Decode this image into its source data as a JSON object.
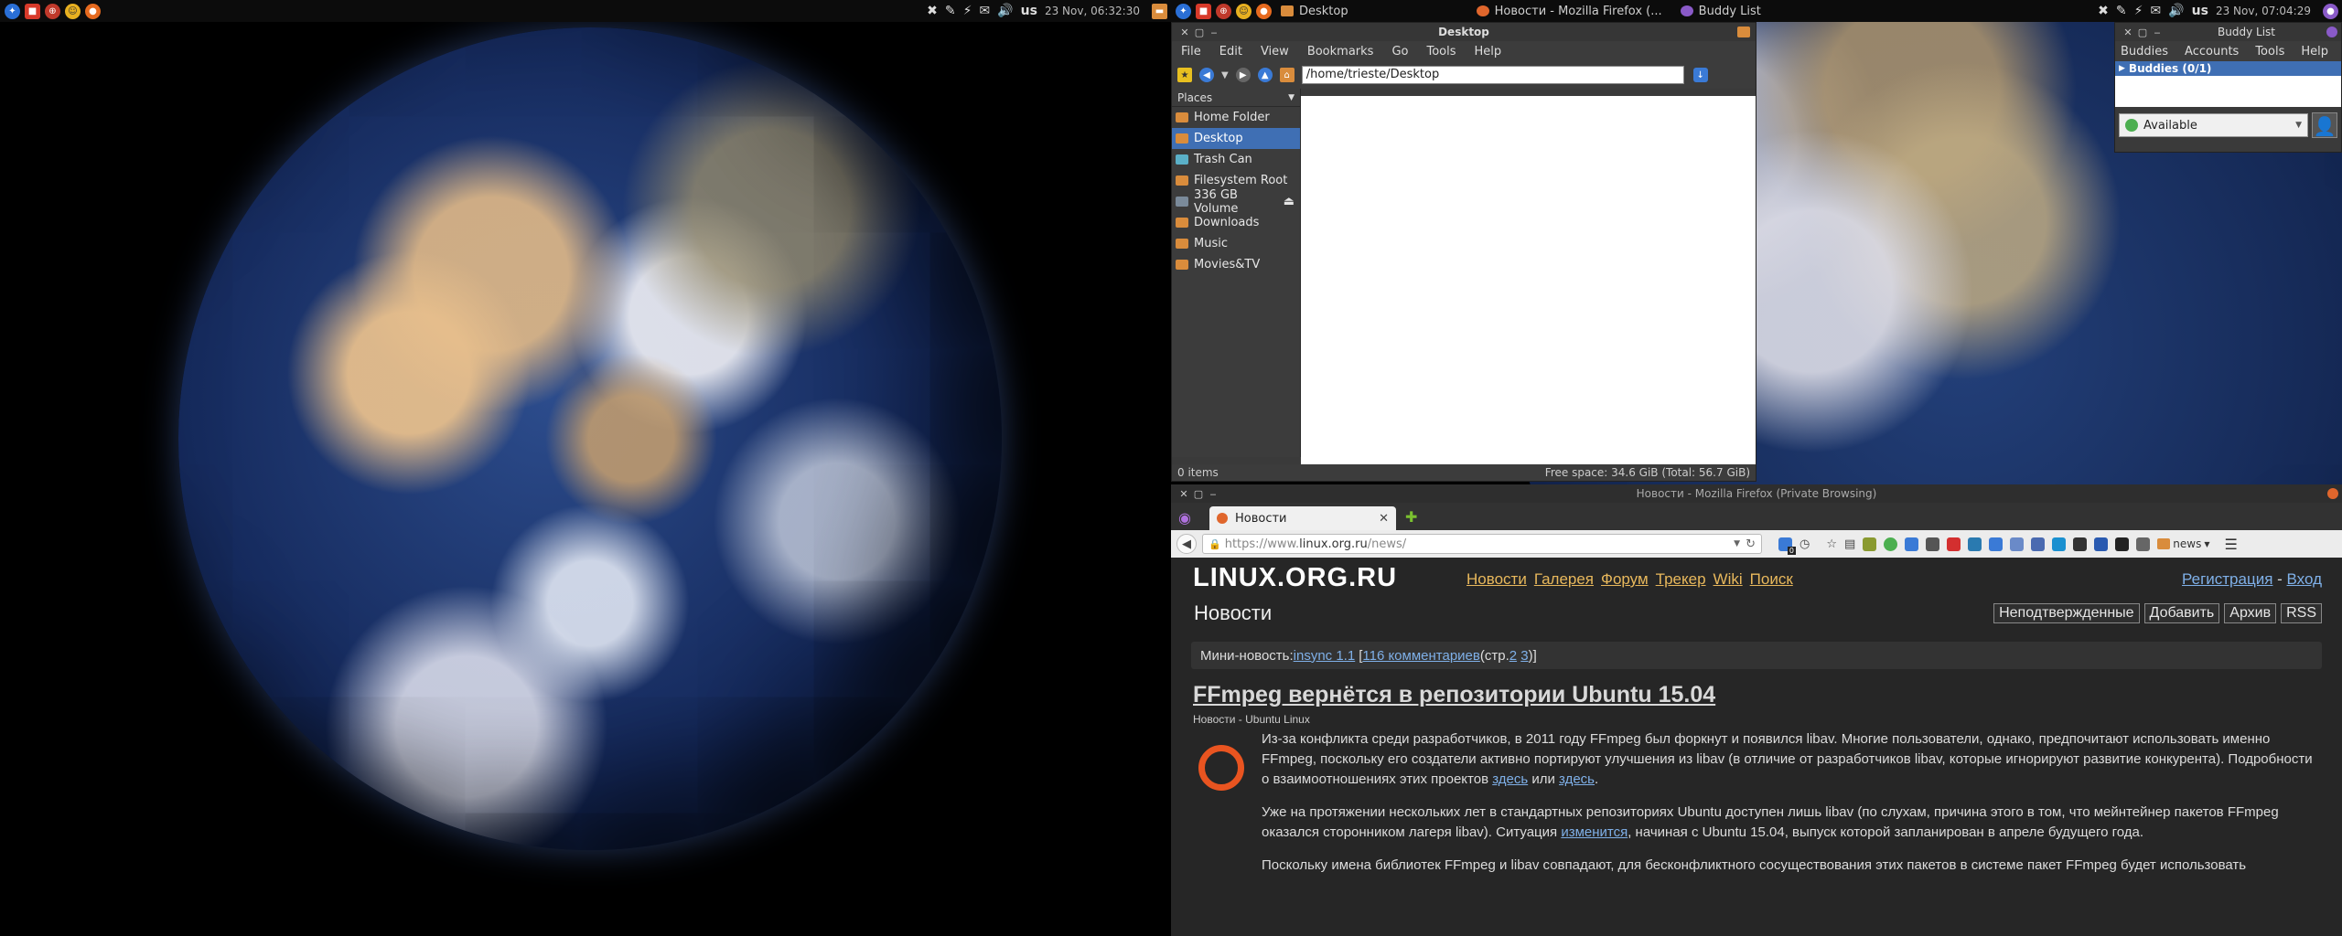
{
  "left_panel": {
    "clock": "23 Nov, 06:32:30",
    "layout": "us"
  },
  "right_panel": {
    "clock": "23 Nov, 07:04:29",
    "layout": "us",
    "tasks": [
      {
        "label": "Desktop",
        "color": "#d98c3c"
      },
      {
        "label": "Новости - Mozilla Firefox (...",
        "color": "#e0662c"
      },
      {
        "label": "Buddy List",
        "color": "#8a5ac8"
      }
    ]
  },
  "file_manager": {
    "title": "Desktop",
    "menu": [
      "File",
      "Edit",
      "View",
      "Bookmarks",
      "Go",
      "Tools",
      "Help"
    ],
    "path": "/home/trieste/Desktop",
    "places_header": "Places",
    "places": [
      {
        "label": "Home Folder",
        "selected": false
      },
      {
        "label": "Desktop",
        "selected": true
      },
      {
        "label": "Trash Can",
        "selected": false
      },
      {
        "label": "Filesystem Root",
        "selected": false
      },
      {
        "label": "336 GB Volume",
        "selected": false
      },
      {
        "label": "Downloads",
        "selected": false
      },
      {
        "label": "Music",
        "selected": false
      },
      {
        "label": "Movies&TV",
        "selected": false
      }
    ],
    "status_left": "0 items",
    "status_right": "Free space: 34.6 GiB (Total: 56.7 GiB)"
  },
  "buddy_list": {
    "title": "Buddy List",
    "menu": [
      "Buddies",
      "Accounts",
      "Tools",
      "Help"
    ],
    "group": "Buddies (0/1)",
    "status": "Available"
  },
  "firefox": {
    "title": "Новости - Mozilla Firefox (Private Browsing)",
    "tab_label": "Новости",
    "url_prefix": "https://www.",
    "url_domain": "linux.org.ru",
    "url_path": "/news/",
    "badge_count": "0",
    "bookmark_label": "news"
  },
  "site": {
    "logo": "LINUX.ORG.RU",
    "nav": [
      "Новости",
      "Галерея",
      "Форум",
      "Трекер",
      "Wiki",
      "Поиск"
    ],
    "auth_register": "Регистрация",
    "auth_sep": " - ",
    "auth_login": "Вход",
    "heading": "Новости",
    "buttons": [
      "Неподтвержденные",
      "Добавить",
      "Архив",
      "RSS"
    ],
    "mini_prefix": "Мини-новость: ",
    "mini_link": "insync 1.1",
    "mini_comments": "116 комментариев",
    "mini_pages_prefix": " (стр. ",
    "mini_page2": "2",
    "mini_page3": "3",
    "mini_suffix": ")]",
    "article_title": "FFmpeg вернётся в репозитории Ubuntu 15.04",
    "article_tags": "Новости - Ubuntu Linux",
    "p1_a": "Из-за конфликта среди разработчиков, в 2011 году FFmpeg был форкнут и появился libav. Многие пользователи, однако, предпочитают использовать именно FFmpeg, поскольку его создатели активно портируют улучшения из libav (в отличие от разработчиков libav, которые игнорируют развитие конкурента). Подробности о взаимоотношениях этих проектов ",
    "p1_link1": "здесь",
    "p1_mid": " или ",
    "p1_link2": "здесь",
    "p1_end": ".",
    "p2_a": "Уже на протяжении нескольких лет в стандартных репозиториях Ubuntu доступен лишь libav (по слухам, причина этого в том, что мейнтейнер пакетов FFmpeg оказался сторонником лагеря libav). Ситуация ",
    "p2_link": "изменится",
    "p2_b": ", начиная с Ubuntu 15.04, выпуск которой запланирован в апреле будущего года.",
    "p3": "Поскольку имена библиотек FFmpeg и libav совпадают, для бесконфликтного сосуществования этих пакетов в системе пакет FFmpeg будет использовать"
  }
}
